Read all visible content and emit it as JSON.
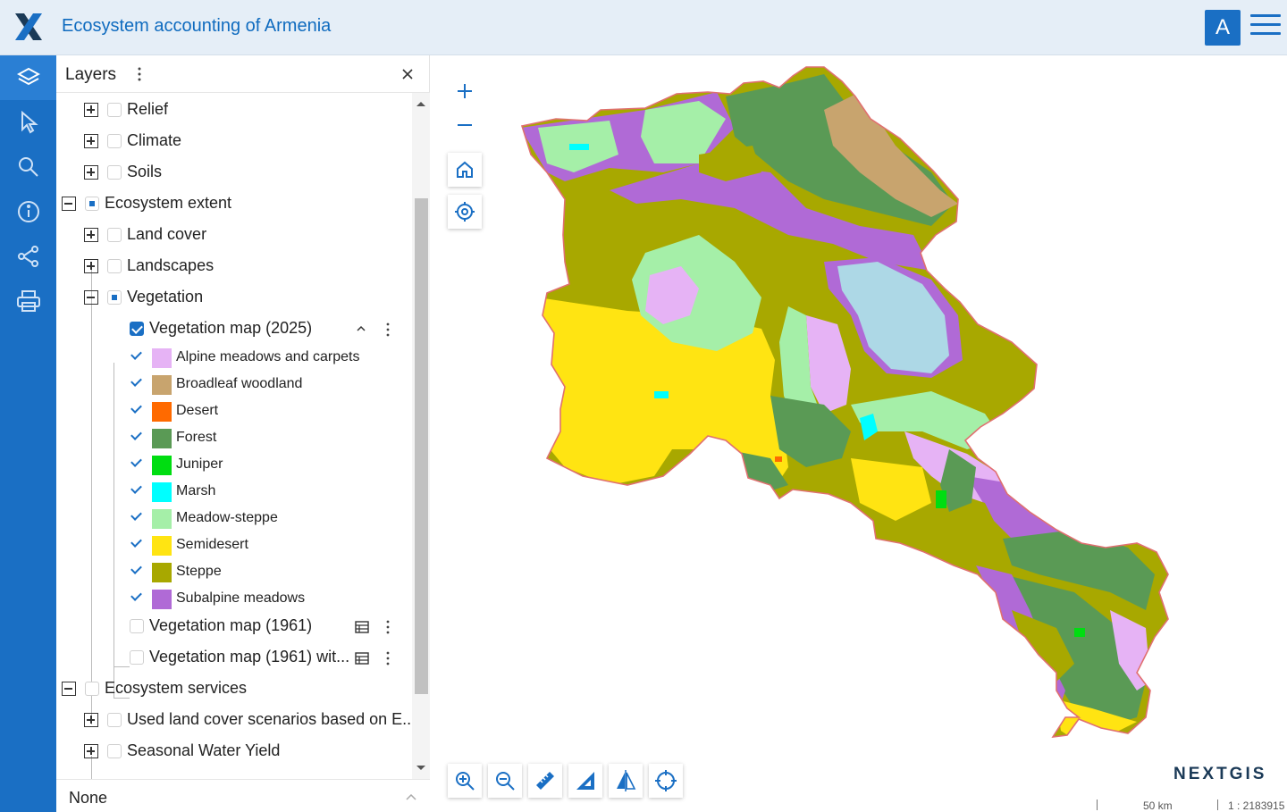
{
  "header": {
    "title": "Ecosystem accounting of Armenia",
    "avatar_letter": "A",
    "logo_icon": "nextgis-x-logo",
    "menu_icon": "hamburger-icon"
  },
  "toolbar": {
    "items": [
      "layers-icon",
      "select-pointer-icon",
      "search-icon",
      "info-icon",
      "share-icon",
      "print-icon"
    ]
  },
  "layers_panel": {
    "title": "Layers",
    "tree": [
      {
        "label": "Relief",
        "level": 1,
        "expanded": false,
        "checked": "none"
      },
      {
        "label": "Climate",
        "level": 1,
        "expanded": false,
        "checked": "none"
      },
      {
        "label": "Soils",
        "level": 1,
        "expanded": false,
        "checked": "none"
      },
      {
        "label": "Ecosystem extent",
        "level": 0,
        "expanded": true,
        "checked": "partial"
      },
      {
        "label": "Land cover",
        "level": 1,
        "expanded": false,
        "checked": "none"
      },
      {
        "label": "Landscapes",
        "level": 1,
        "expanded": false,
        "checked": "none"
      },
      {
        "label": "Vegetation",
        "level": 1,
        "expanded": true,
        "checked": "partial"
      },
      {
        "label": "Vegetation map (2025)",
        "level": 2,
        "checked": "checked"
      },
      {
        "label": "Vegetation map (1961)",
        "level": 2,
        "checked": "none"
      },
      {
        "label": "Vegetation map (1961) wit...",
        "level": 2,
        "checked": "none"
      },
      {
        "label": "Ecosystem services",
        "level": 0,
        "expanded": true,
        "checked": "none"
      },
      {
        "label": "Used land cover scenarios based on E...",
        "level": 1,
        "expanded": false,
        "checked": "none"
      },
      {
        "label": "Seasonal Water Yield",
        "level": 1,
        "expanded": false,
        "checked": "none"
      }
    ],
    "legend": [
      {
        "label": "Alpine meadows and carpets",
        "color": "#e6b3f5"
      },
      {
        "label": "Broadleaf woodland",
        "color": "#c8a46e"
      },
      {
        "label": "Desert",
        "color": "#ff6a00"
      },
      {
        "label": "Forest",
        "color": "#5a9a55"
      },
      {
        "label": "Juniper",
        "color": "#00dd11"
      },
      {
        "label": "Marsh",
        "color": "#00ffff"
      },
      {
        "label": "Meadow-steppe",
        "color": "#a5efa8"
      },
      {
        "label": "Semidesert",
        "color": "#ffe412"
      },
      {
        "label": "Steppe",
        "color": "#a8a800"
      },
      {
        "label": "Subalpine meadows",
        "color": "#b06ad6"
      }
    ],
    "basemap": "None"
  },
  "map": {
    "brand": "NEXTGIS",
    "scale_distance": "50 km",
    "scale_ratio": "1 : 2183915",
    "boundary_color": "#e07070"
  }
}
